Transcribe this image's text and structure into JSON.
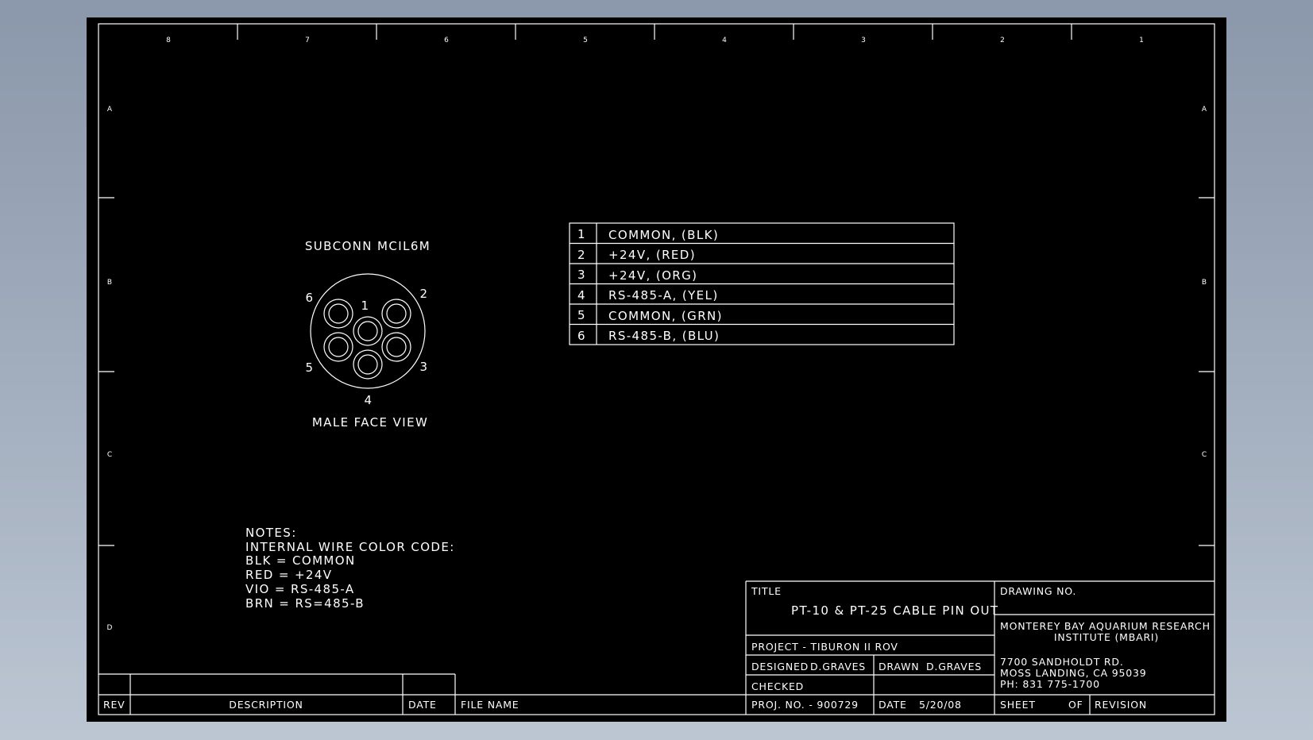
{
  "drawing": {
    "zone_numbers": [
      "8",
      "7",
      "6",
      "5",
      "4",
      "3",
      "2",
      "1"
    ],
    "zone_letters": [
      "A",
      "B",
      "C",
      "D"
    ],
    "connector": {
      "name": "SUBCONN MCIL6M",
      "view": "MALE FACE VIEW",
      "pins": [
        "1",
        "2",
        "3",
        "4",
        "5",
        "6"
      ]
    },
    "pin_table": [
      {
        "pin": "1",
        "signal": "COMMON, (BLK)"
      },
      {
        "pin": "2",
        "signal": "+24V, (RED)"
      },
      {
        "pin": "3",
        "signal": "+24V, (ORG)"
      },
      {
        "pin": "4",
        "signal": "RS-485-A, (YEL)"
      },
      {
        "pin": "5",
        "signal": "COMMON, (GRN)"
      },
      {
        "pin": "6",
        "signal": "RS-485-B, (BLU)"
      }
    ],
    "notes": [
      "NOTES:",
      "INTERNAL WIRE COLOR CODE:",
      "BLK = COMMON",
      "RED = +24V",
      "VIO = RS-485-A",
      "BRN = RS=485-B"
    ]
  },
  "title_block": {
    "title_label": "TITLE",
    "title": "PT-10 & PT-25 CABLE PIN OUT",
    "drawing_no_label": "DRAWING NO.",
    "org_line1": "MONTEREY BAY AQUARIUM RESEARCH",
    "org_line2": "INSTITUTE (MBARI)",
    "addr1": "7700 SANDHOLDT RD.",
    "addr2": "MOSS LANDING, CA 95039",
    "phone": "PH: 831 775-1700",
    "project": "PROJECT  -  TIBURON II ROV",
    "designed_label": "DESIGNED",
    "designed": "D.GRAVES",
    "drawn_label": "DRAWN",
    "drawn": "D.GRAVES",
    "checked_label": "CHECKED",
    "proj_no": "PROJ. NO. - 900729",
    "date_label": "DATE",
    "date": "5/20/08",
    "sheet_label": "SHEET",
    "of_label": "OF",
    "revision_label": "REVISION"
  },
  "revision_block": {
    "rev_label": "REV",
    "description_label": "DESCRIPTION",
    "date_label": "DATE",
    "file_name_label": "FILE NAME"
  }
}
